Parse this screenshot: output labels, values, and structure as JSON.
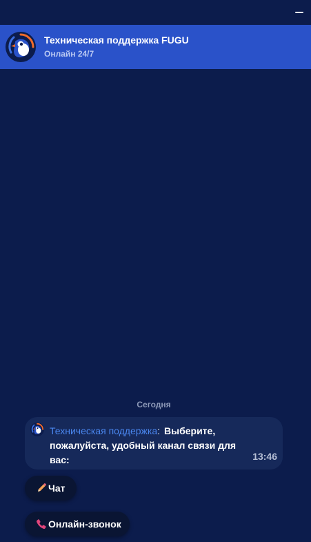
{
  "window": {
    "minimize_icon": "minimize-icon"
  },
  "header": {
    "title": "Техническая поддержка FUGU",
    "status": "Онлайн 24/7",
    "avatar_icon": "fugu-bird-logo-icon",
    "background_color": "#2a52c9"
  },
  "chat": {
    "background_color": "#0c1c4c",
    "date_separator": "Сегодня",
    "messages": [
      {
        "sender": "Техническая поддержка",
        "separator": ":",
        "text": "Выберите, пожалуйста, удобный канал связи для вас:",
        "time": "13:46",
        "avatar_icon": "fugu-bird-logo-icon"
      }
    ]
  },
  "quick_replies": [
    {
      "label": "Чат",
      "icon": "pencil-icon"
    },
    {
      "label": "Онлайн-звонок",
      "icon": "phone-icon"
    }
  ],
  "colors": {
    "sender_name": "#4a86ee",
    "bubble": "#16295a",
    "quick_reply_button": "#0a1533"
  }
}
